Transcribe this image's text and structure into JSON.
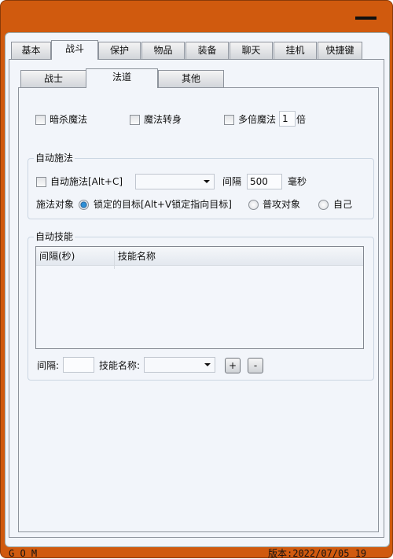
{
  "outer_tabs": [
    "基本",
    "战斗",
    "保护",
    "物品",
    "装备",
    "聊天",
    "挂机",
    "快捷键"
  ],
  "outer_selected": "战斗",
  "inner_tabs": [
    "战士",
    "法道",
    "其他"
  ],
  "inner_selected": "法道",
  "options": {
    "assassinate": "暗杀魔法",
    "magic_turn": "魔法转身",
    "multi_magic": "多倍魔法",
    "multi_value": "1",
    "multi_unit": "倍"
  },
  "auto_cast": {
    "group_label": "自动施法",
    "checkbox_label": "自动施法[Alt+C]",
    "skill_value": "",
    "interval_label": "间隔",
    "interval_value": "500",
    "interval_unit": "毫秒",
    "target_label": "施法对象",
    "targets": [
      "锁定的目标[Alt+V锁定指向目标]",
      "普攻对象",
      "自己"
    ],
    "selected_target": "锁定的目标[Alt+V锁定指向目标]"
  },
  "auto_skill": {
    "group_label": "自动技能",
    "columns": [
      "间隔(秒)",
      "技能名称"
    ],
    "rows": [],
    "interval_label": "间隔:",
    "interval_value": "",
    "name_label": "技能名称:",
    "name_value": "",
    "add_label": "+",
    "remove_label": "-"
  },
  "status": {
    "left": "G O M",
    "right": "版本:2022/07/05 19"
  },
  "colors": {
    "frame": "#d05a0e",
    "panel": "#f2f5fa"
  }
}
